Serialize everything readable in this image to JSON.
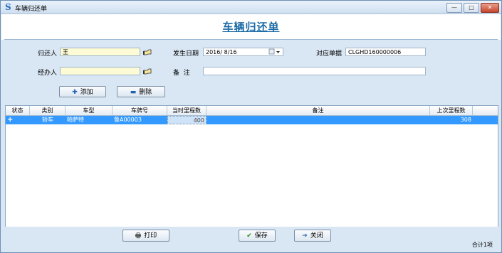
{
  "window": {
    "title": "车辆归还单",
    "app_icon": "S",
    "min_glyph": "—",
    "max_glyph": "□",
    "close_glyph": "✕"
  },
  "form": {
    "heading": "车辆归还单",
    "returner_label": "归还人",
    "returner_value": "王",
    "handler_label": "经办人",
    "handler_value": "",
    "date_label": "发生日期",
    "date_value": "2016/ 8/16",
    "remark_label": "备  注",
    "remark_value": "",
    "voucher_label": "对应单据",
    "voucher_value": "CLGHD160000006",
    "add_label": "添加",
    "delete_label": "删除"
  },
  "grid": {
    "columns": [
      "状态",
      "类别",
      "车型",
      "车牌号",
      "当时里程数",
      "备注",
      "上次里程数"
    ],
    "rows": [
      {
        "status": "+",
        "category": "轿车",
        "model": "帕萨特",
        "plate": "鲁A00003",
        "current_mileage": "400",
        "remark": "",
        "last_mileage": "308"
      }
    ]
  },
  "footer": {
    "print_label": "打印",
    "save_label": "保存",
    "close_label": "关闭",
    "total_text": "合计1项"
  },
  "colors": {
    "accent": "#1c6aa6",
    "selected_row": "#3399ff",
    "window_bg": "#d9e6f3",
    "input_highlight": "#fdfbd6"
  },
  "icons": [
    "app-logo-icon",
    "lookup-hand-icon",
    "calendar-dropdown-icon",
    "add-plus-icon",
    "delete-minus-icon",
    "printer-icon",
    "checkmark-icon",
    "exit-icon"
  ]
}
